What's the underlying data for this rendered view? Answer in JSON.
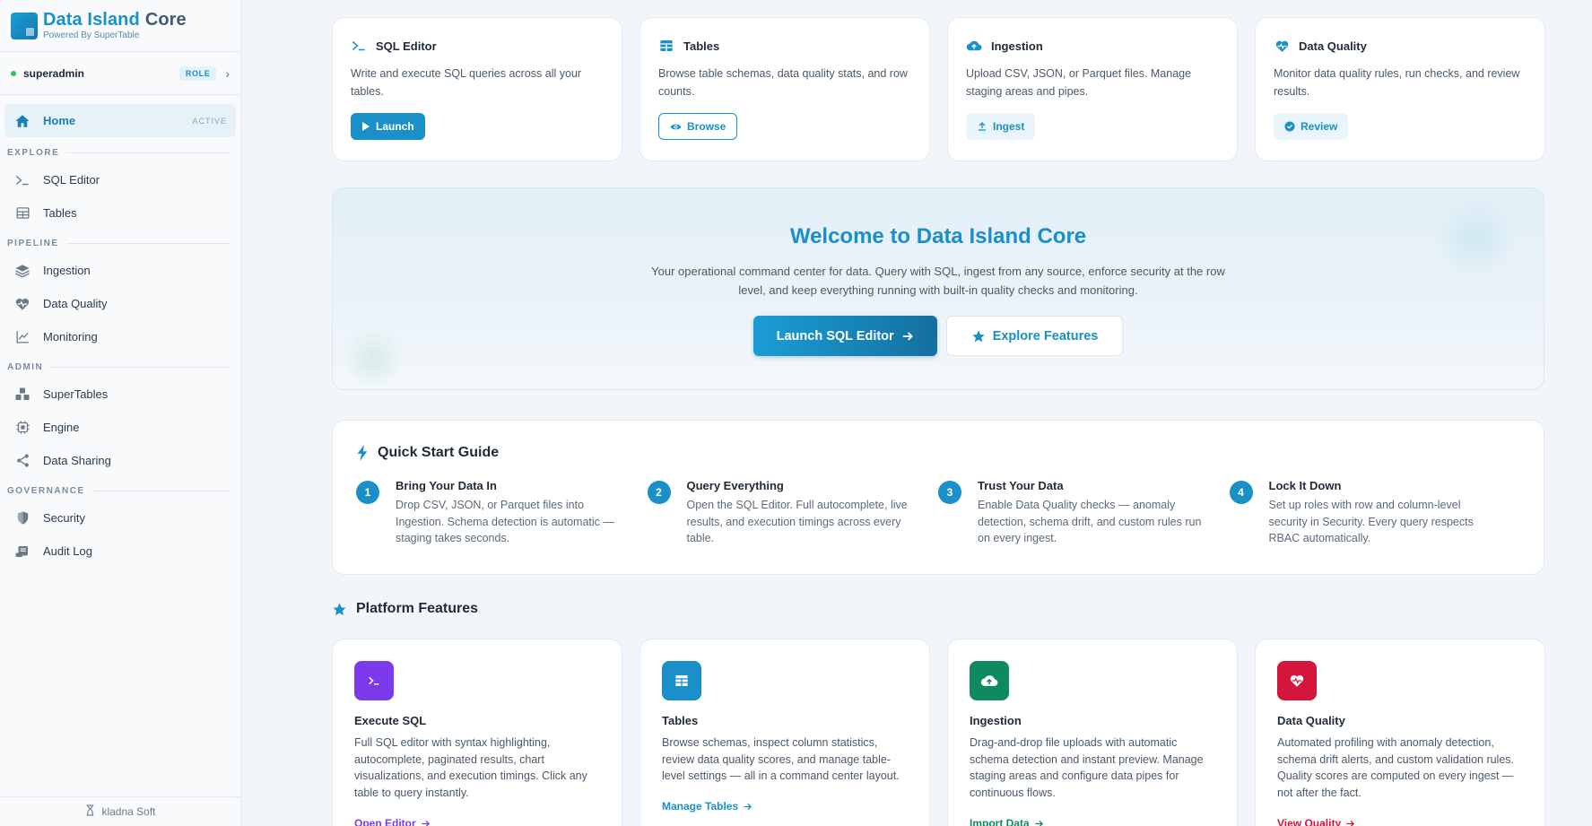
{
  "brand": {
    "name": "Data Island",
    "name_suffix": "Core",
    "tagline": "Powered By SuperTable"
  },
  "user": {
    "name": "superadmin",
    "role_badge": "ROLE"
  },
  "nav": {
    "home": {
      "label": "Home",
      "tag": "ACTIVE"
    },
    "sections": {
      "explore": "EXPLORE",
      "pipeline": "PIPELINE",
      "admin": "ADMIN",
      "governance": "GOVERNANCE"
    },
    "items": {
      "sql_editor": "SQL Editor",
      "tables": "Tables",
      "ingestion": "Ingestion",
      "data_quality": "Data Quality",
      "monitoring": "Monitoring",
      "supertables": "SuperTables",
      "engine": "Engine",
      "data_sharing": "Data Sharing",
      "security": "Security",
      "audit_log": "Audit Log"
    }
  },
  "footer": {
    "label": "kladna Soft"
  },
  "quick_actions": [
    {
      "title": "SQL Editor",
      "desc": "Write and execute SQL queries across all your tables.",
      "button": "Launch"
    },
    {
      "title": "Tables",
      "desc": "Browse table schemas, data quality stats, and row counts.",
      "button": "Browse"
    },
    {
      "title": "Ingestion",
      "desc": "Upload CSV, JSON, or Parquet files. Manage staging areas and pipes.",
      "button": "Ingest"
    },
    {
      "title": "Data Quality",
      "desc": "Monitor data quality rules, run checks, and review results.",
      "button": "Review"
    }
  ],
  "hero": {
    "title": "Welcome to Data Island Core",
    "desc": "Your operational command center for data. Query with SQL, ingest from any source, enforce security at the row level, and keep everything running with built-in quality checks and monitoring.",
    "primary_button": "Launch SQL Editor",
    "secondary_button": "Explore Features"
  },
  "quick_start": {
    "title": "Quick Start Guide",
    "steps": [
      {
        "num": "1",
        "title": "Bring Your Data In",
        "desc": "Drop CSV, JSON, or Parquet files into Ingestion. Schema detection is automatic — staging takes seconds."
      },
      {
        "num": "2",
        "title": "Query Everything",
        "desc": "Open the SQL Editor. Full autocomplete, live results, and execution timings across every table."
      },
      {
        "num": "3",
        "title": "Trust Your Data",
        "desc": "Enable Data Quality checks — anomaly detection, schema drift, and custom rules run on every ingest."
      },
      {
        "num": "4",
        "title": "Lock It Down",
        "desc": "Set up roles with row and column-level security in Security. Every query respects RBAC automatically."
      }
    ]
  },
  "features": {
    "title": "Platform Features",
    "cards": [
      {
        "title": "Execute SQL",
        "desc": "Full SQL editor with syntax highlighting, autocomplete, paginated results, chart visualizations, and execution timings. Click any table to query instantly.",
        "link": "Open Editor",
        "color": "#7c3aed",
        "icon": "terminal-icon"
      },
      {
        "title": "Tables",
        "desc": "Browse schemas, inspect column statistics, review data quality scores, and manage table-level settings — all in a command center layout.",
        "link": "Manage Tables",
        "color": "#1a8fc8",
        "icon": "table-icon"
      },
      {
        "title": "Ingestion",
        "desc": "Drag-and-drop file uploads with automatic schema detection and instant preview. Manage staging areas and configure data pipes for continuous flows.",
        "link": "Import Data",
        "color": "#0f8a5f",
        "icon": "cloud-upload-icon"
      },
      {
        "title": "Data Quality",
        "desc": "Automated profiling with anomaly detection, schema drift alerts, and custom validation rules. Quality scores are computed on every ingest — not after the fact.",
        "link": "View Quality",
        "color": "#d4163c",
        "icon": "heart-pulse-icon"
      }
    ]
  }
}
